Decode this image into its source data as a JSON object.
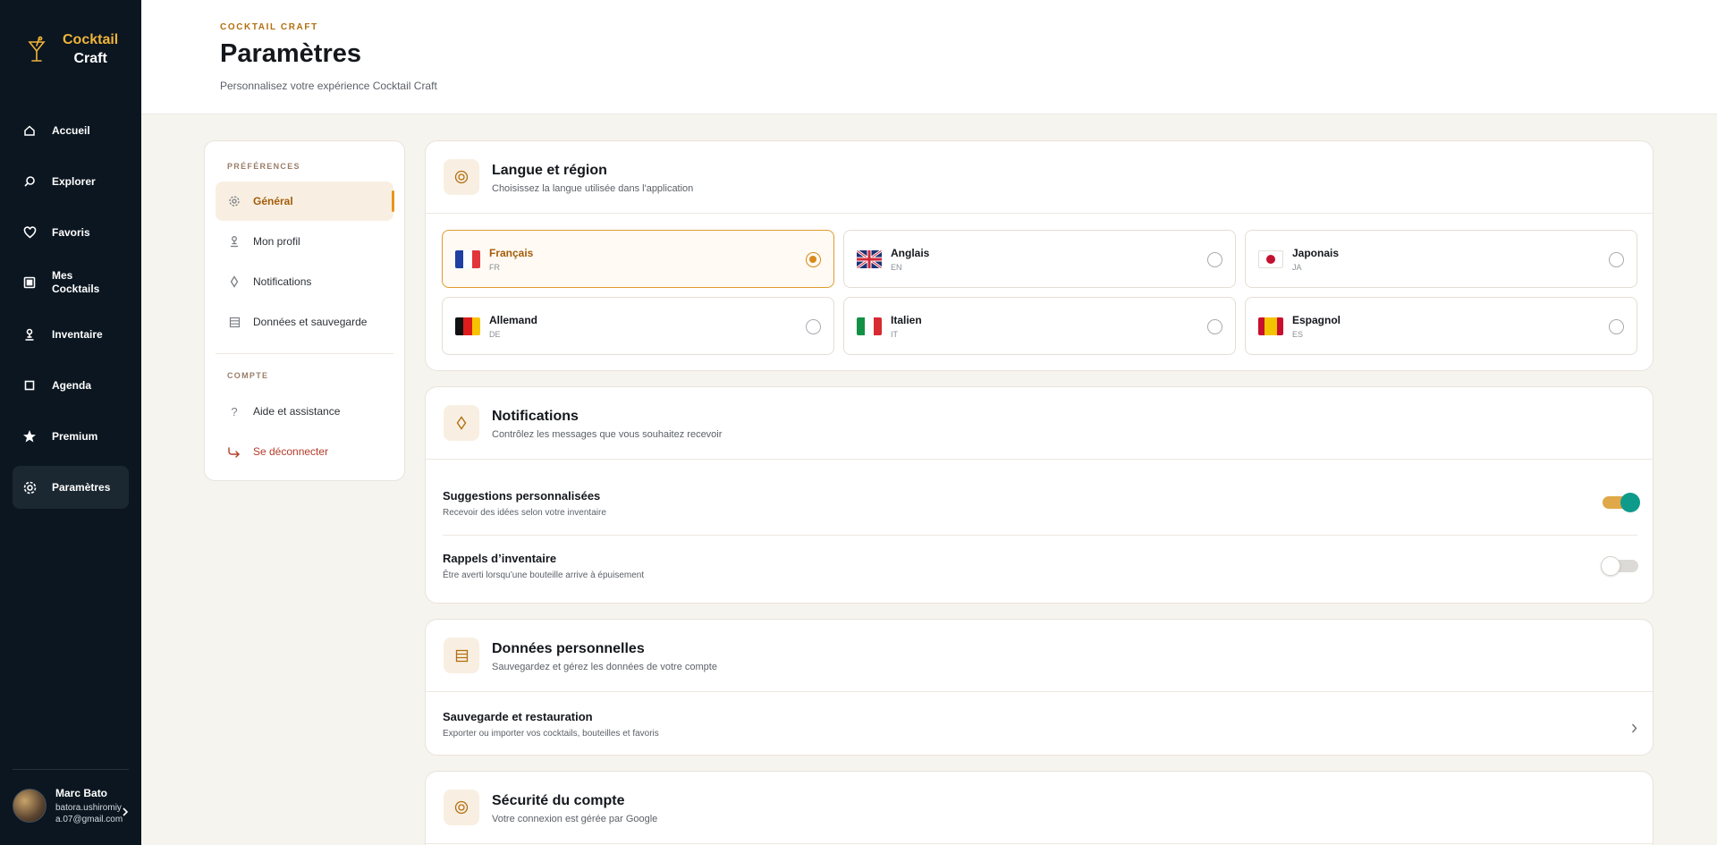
{
  "app": {
    "logo_line1": "Cocktail",
    "logo_line2": "Craft"
  },
  "sidebar": {
    "items": [
      {
        "label": "Accueil",
        "icon": "home-icon"
      },
      {
        "label": "Explorer",
        "icon": "search-icon"
      },
      {
        "label": "Favoris",
        "icon": "heart-icon"
      },
      {
        "label": "Mes Cocktails",
        "icon": "cocktails-icon"
      },
      {
        "label": "Inventaire",
        "icon": "bottle-icon"
      },
      {
        "label": "Agenda",
        "icon": "calendar-icon"
      },
      {
        "label": "Premium",
        "icon": "star-icon"
      },
      {
        "label": "Paramètres",
        "icon": "gear-icon",
        "active": true
      }
    ]
  },
  "user": {
    "name": "Marc Bato",
    "email": "batora.ushiromiya.07@gmail.com"
  },
  "header": {
    "eyebrow": "COCKTAIL CRAFT",
    "title": "Paramètres",
    "subtitle": "Personnalisez votre expérience Cocktail Craft"
  },
  "settings_nav": {
    "section_preferences": "PRÉFÉRENCES",
    "section_account": "COMPTE",
    "items": [
      {
        "label": "Général",
        "icon": "gear-icon",
        "active": true
      },
      {
        "label": "Mon profil",
        "icon": "user-icon"
      },
      {
        "label": "Notifications",
        "icon": "diamond-icon"
      },
      {
        "label": "Données et sauvegarde",
        "icon": "storage-icon"
      },
      {
        "label": "Aide et assistance",
        "icon": "question-icon"
      },
      {
        "label": "Se déconnecter",
        "icon": "logout-icon"
      }
    ]
  },
  "language": {
    "title": "Langue et région",
    "subtitle": "Choisissez la langue utilisée dans l'application",
    "options": [
      {
        "name": "Français",
        "code": "FR",
        "selected": true
      },
      {
        "name": "Anglais",
        "code": "EN"
      },
      {
        "name": "Japonais",
        "code": "JA"
      },
      {
        "name": "Allemand",
        "code": "DE"
      },
      {
        "name": "Italien",
        "code": "IT"
      },
      {
        "name": "Espagnol",
        "code": "ES"
      }
    ]
  },
  "notifications": {
    "title": "Notifications",
    "subtitle": "Contrôlez les messages que vous souhaitez recevoir",
    "rows": [
      {
        "title": "Suggestions personnalisées",
        "desc": "Recevoir des idées selon votre inventaire",
        "enabled": true
      },
      {
        "title": "Rappels d’inventaire",
        "desc": "Être averti lorsqu’une bouteille arrive à épuisement",
        "enabled": false
      }
    ]
  },
  "personal_data": {
    "title": "Données personnelles",
    "subtitle": "Sauvegardez et gérez les données de votre compte",
    "row_title": "Sauvegarde et restauration",
    "row_desc": "Exporter ou importer vos cocktails, bouteilles et favoris"
  },
  "security": {
    "title": "Sécurité du compte",
    "subtitle": "Votre connexion est gérée par Google"
  },
  "colors": {
    "sidebar_bg": "#0b1620",
    "accent": "#e7961a",
    "accent_text": "#a35d0a",
    "toggle_knob": "#0f9b8c",
    "danger": "#b43b2a"
  }
}
